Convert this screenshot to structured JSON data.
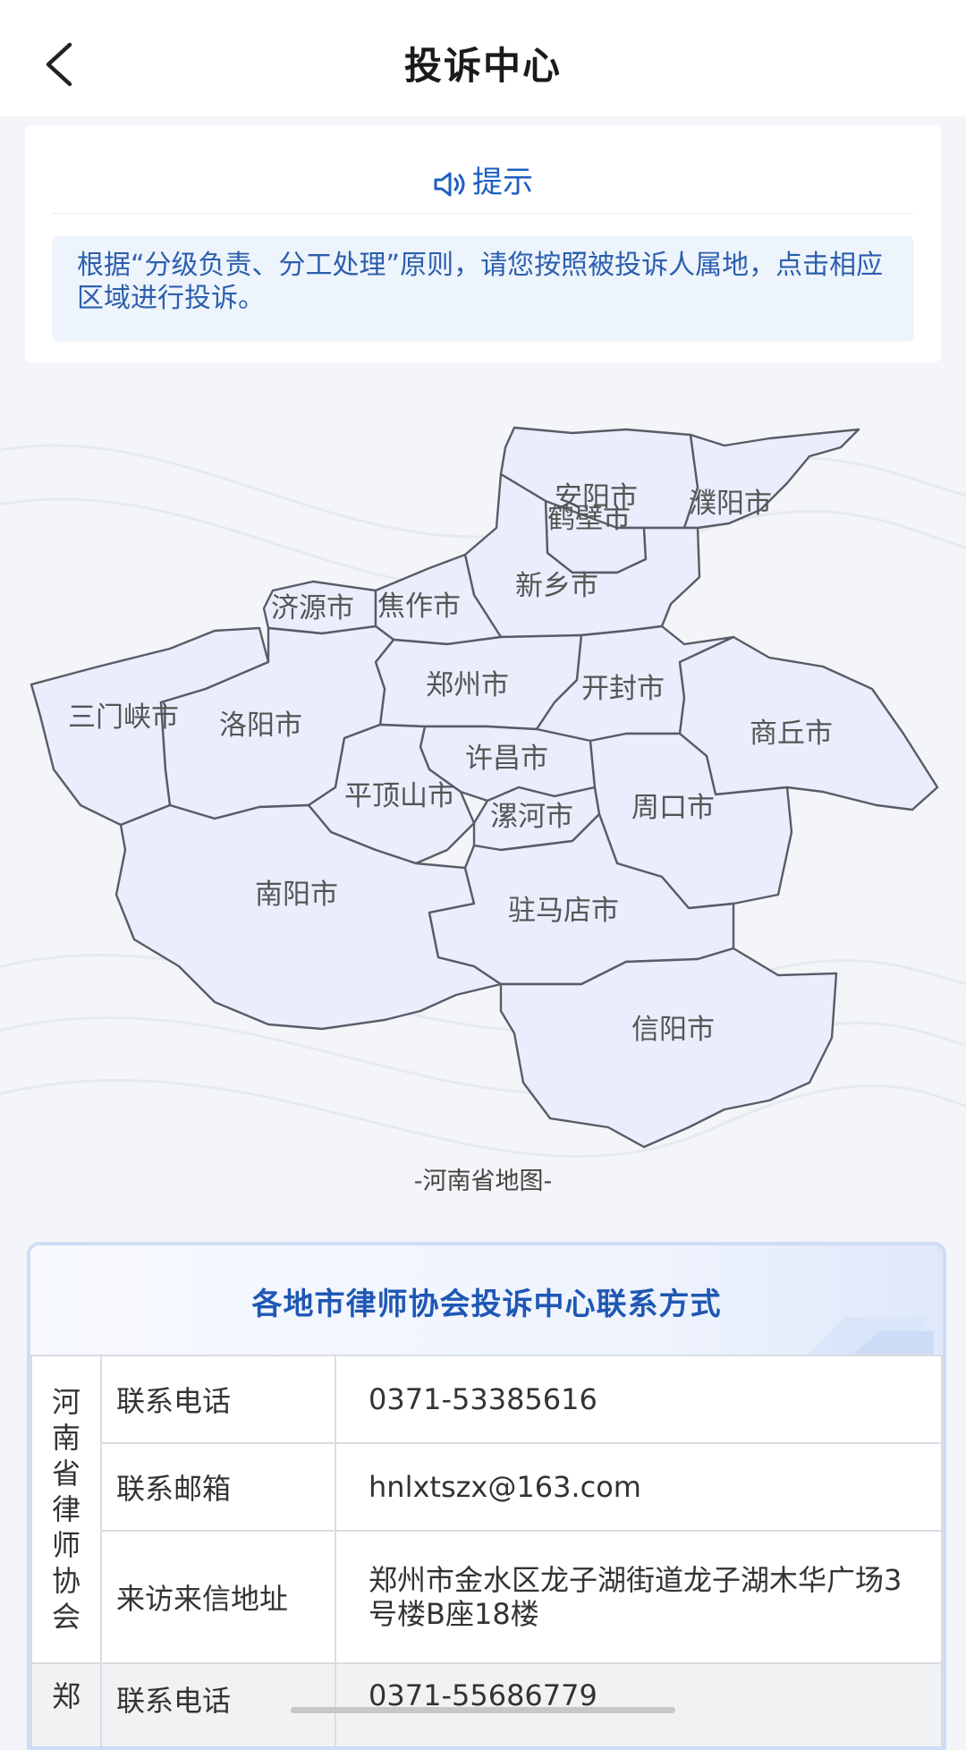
{
  "header": {
    "title": "投诉中心"
  },
  "tip": {
    "title": "提示",
    "text": "根据“分级负责、分工处理”原则，请您按照被投诉人属地，点击相应区域进行投诉。"
  },
  "map": {
    "caption": "-河南省地图-",
    "regions": [
      "安阳市",
      "鹤壁市",
      "濮阳市",
      "新乡市",
      "济源市",
      "焦作市",
      "郑州市",
      "开封市",
      "商丘市",
      "三门峡市",
      "洛阳市",
      "许昌市",
      "平顶山市",
      "漯河市",
      "周口市",
      "南阳市",
      "驻马店市",
      "信阳市"
    ]
  },
  "contacts": {
    "title": "各地市律师协会投诉中心联系方式",
    "orgs": [
      {
        "name": "河南省律师协会",
        "rows": [
          {
            "key": "联系电话",
            "value": "0371-53385616"
          },
          {
            "key": "联系邮箱",
            "value": "hnlxtszx@163.com"
          },
          {
            "key": "来访来信地址",
            "value": "郑州市金水区龙子湖街道龙子湖木华广场3号楼B座18楼"
          }
        ]
      },
      {
        "name": "郑",
        "rows": [
          {
            "key": "联系电话",
            "value": "0371-55686779"
          }
        ]
      }
    ]
  },
  "colors": {
    "accent": "#1f5fc2",
    "region_fill": "#eaeefc",
    "border": "#585c66"
  }
}
